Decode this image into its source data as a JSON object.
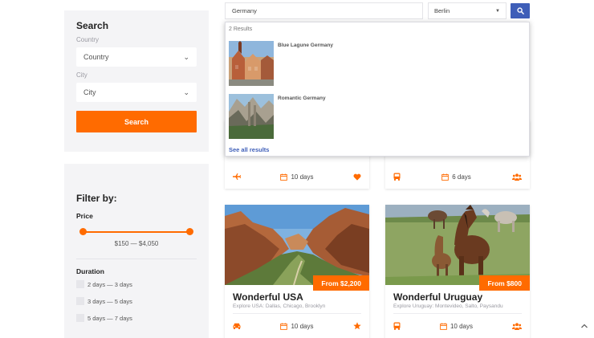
{
  "search_panel": {
    "title": "Search",
    "country_label": "Country",
    "country_value": "Country",
    "city_label": "City",
    "city_value": "City",
    "button_label": "Search"
  },
  "filter_panel": {
    "title": "Filter by:",
    "price_label": "Price",
    "price_range": "$150 — $4,050",
    "duration_label": "Duration",
    "durations": [
      "2  days — 3  days",
      "3  days — 5  days",
      "5  days — 7  days"
    ]
  },
  "top_search": {
    "query": "Germany",
    "city": "Berlin"
  },
  "dropdown": {
    "count": "2 Results",
    "items": [
      {
        "name": "Blue Lagune Germany"
      },
      {
        "name": "Romantic Germany"
      }
    ],
    "see_all": "See all results"
  },
  "cards": [
    {
      "duration": "10 days"
    },
    {
      "duration": "6 days"
    },
    {
      "title": "Wonderful USA",
      "desc": "Explore USA: Dallas, Chicago, Brooklyn",
      "price": "From $2,200",
      "duration": "10 days"
    },
    {
      "title": "Wonderful Uruguay",
      "desc": "Explore Uruguay: Montevideo, Salto, Paysandu",
      "price": "From $800",
      "duration": "10 days"
    }
  ],
  "colors": {
    "accent": "#ff6b00",
    "primary": "#3e5eb8"
  }
}
